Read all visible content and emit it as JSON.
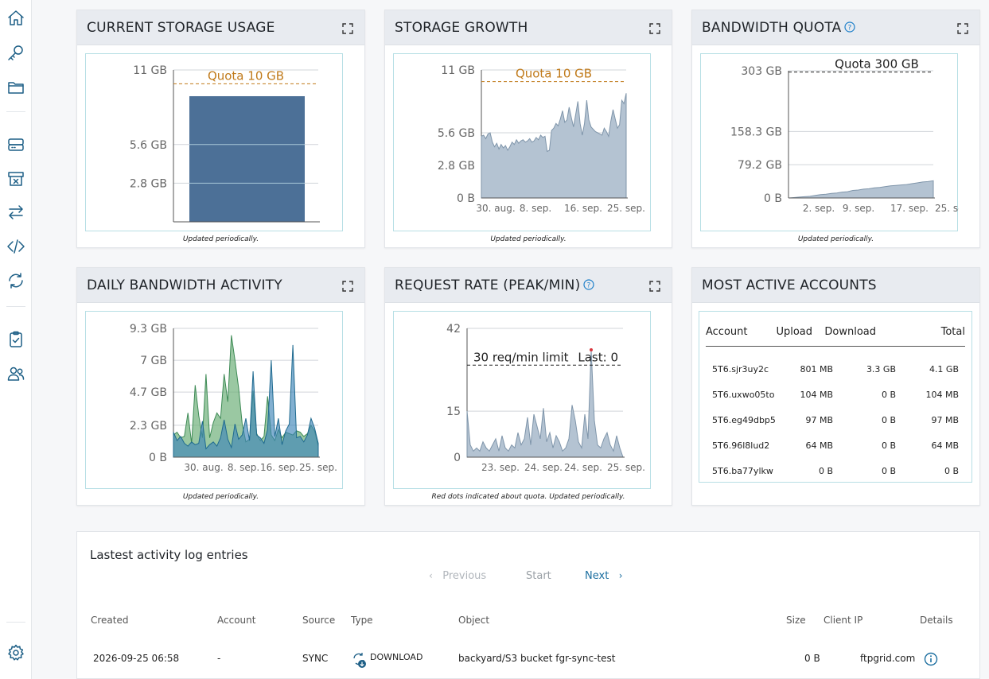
{
  "sidebar": {
    "icons": [
      "home-icon",
      "key-icon",
      "folder-icon",
      "server-icon",
      "archive-icon",
      "transfer-icon",
      "code-icon",
      "sync-icon",
      "clipboard-check-icon",
      "users-icon",
      "settings-icon"
    ]
  },
  "colors": {
    "accent": "#1d5f86",
    "quota_line": "#c07a1a",
    "area_fill": "#b4c3d2",
    "bar_fill": "#4c7097",
    "green": "#6fb07a",
    "blue": "#3f86b8",
    "red_dot": "#d9363e"
  },
  "cards": {
    "storage_usage": {
      "title": "CURRENT STORAGE USAGE",
      "note": "Updated periodically."
    },
    "storage_growth": {
      "title": "STORAGE GROWTH",
      "note": "Updated periodically."
    },
    "bandwidth_quota": {
      "title": "BANDWIDTH QUOTA",
      "note": "Updated periodically."
    },
    "daily_bandwidth": {
      "title": "DAILY BANDWIDTH ACTIVITY",
      "note": "Updated periodically."
    },
    "request_rate": {
      "title": "REQUEST RATE (PEAK/MIN)",
      "note": "Red dots indicated about quota. Updated periodically."
    },
    "active_accounts": {
      "title": "MOST ACTIVE ACCOUNTS",
      "columns": [
        "Account",
        "Upload",
        "Download",
        "Total"
      ],
      "rows": [
        [
          "5T6.sjr3uy2c",
          "801 MB",
          "3.3 GB",
          "4.1 GB"
        ],
        [
          "5T6.uxwo05to",
          "104 MB",
          "0 B",
          "104 MB"
        ],
        [
          "5T6.eg49dbp5",
          "97 MB",
          "0 B",
          "97 MB"
        ],
        [
          "5T6.96l8lud2",
          "64 MB",
          "0 B",
          "64 MB"
        ],
        [
          "5T6.ba77ylkw",
          "0 B",
          "0 B",
          "0 B"
        ]
      ]
    }
  },
  "chart_data": [
    {
      "id": "storage_usage",
      "type": "bar",
      "ytick_labels": [
        "2.8 GB",
        "5.6 GB",
        "11 GB"
      ],
      "yticks": [
        2.8,
        5.6,
        11
      ],
      "ylim": [
        0,
        11
      ],
      "values": [
        9.1
      ],
      "annotations": [
        {
          "text": "Quota 10 GB",
          "y": 10
        }
      ]
    },
    {
      "id": "storage_growth",
      "type": "area",
      "ytick_labels": [
        "0 B",
        "2.8 GB",
        "5.6 GB",
        "11 GB"
      ],
      "yticks": [
        0,
        2.8,
        5.6,
        11
      ],
      "ylim": [
        0,
        11
      ],
      "xtick_labels": [
        "30. aug.",
        "8. sep.",
        "16. sep.",
        "25. sep."
      ],
      "annotations": [
        {
          "text": "Quota 10 GB",
          "y": 10
        }
      ],
      "values": [
        5.3,
        5.4,
        5.1,
        5.5,
        5.6,
        4.8,
        4.4,
        4.7,
        4.2,
        4.6,
        4.3,
        4.5,
        4.1,
        4.4,
        4.8,
        4.6,
        5.0,
        4.7,
        4.9,
        5.0,
        4.8,
        4.9,
        5.1,
        4.8,
        4.9,
        5.2,
        5.0,
        5.4,
        5.2,
        5.3,
        4.0,
        4.1,
        5.8,
        6.0,
        6.4,
        6.2,
        6.8,
        7.5,
        6.5,
        6.7,
        7.8,
        6.9,
        6.1,
        7.2,
        8.3,
        6.4,
        5.4,
        6.4,
        8.4,
        6.7,
        6.1,
        5.9,
        5.7,
        5.6,
        5.5,
        5.4,
        6.0,
        5.7,
        5.3,
        6.6,
        7.6,
        6.8,
        6.0,
        6.3,
        8.4,
        8.1,
        9.0
      ]
    },
    {
      "id": "bandwidth_quota",
      "type": "area",
      "ytick_labels": [
        "0 B",
        "79.2 GB",
        "158.3 GB",
        "303 GB"
      ],
      "yticks": [
        0,
        79.2,
        158.3,
        303
      ],
      "ylim": [
        0,
        303
      ],
      "xtick_labels": [
        "2. sep.",
        "9. sep.",
        "17. sep.",
        "25. sep."
      ],
      "annotations": [
        {
          "text": "Quota 300 GB",
          "y": 300
        }
      ],
      "values": [
        0,
        1,
        2,
        3,
        4,
        6,
        8,
        9,
        11,
        12,
        14,
        15,
        18,
        19,
        21,
        22,
        24,
        25,
        27,
        29,
        30,
        31,
        32,
        34,
        36,
        38,
        39,
        41
      ]
    },
    {
      "id": "daily_bandwidth",
      "type": "area",
      "ytick_labels": [
        "0 B",
        "2.3 GB",
        "4.7 GB",
        "7 GB",
        "9.3 GB"
      ],
      "yticks": [
        0,
        2.3,
        4.7,
        7,
        9.3
      ],
      "ylim": [
        0,
        9.3
      ],
      "xtick_labels": [
        "30. aug.",
        "8. sep.",
        "16. sep.",
        "25. sep."
      ],
      "series": [
        {
          "values": [
            1.6,
            1.8,
            1.4,
            1.5,
            3.2,
            1.0,
            5.2,
            3.0,
            1.4,
            6.0,
            1.4,
            2.5,
            3.2,
            2.8,
            6.0,
            4.0,
            8.8,
            7.0,
            5.0,
            2.4,
            1.1,
            1.3,
            4.8,
            1.7,
            1.2,
            1.5,
            4.4,
            1.6,
            1.2,
            2.0,
            1.4,
            1.8,
            1.7,
            1.6,
            1.9,
            1.8,
            1.5,
            1.7,
            2.3,
            1.9,
            0.8
          ]
        },
        {
          "values": [
            1.8,
            1.2,
            1.5,
            1.0,
            0.8,
            1.1,
            0.9,
            1.0,
            2.6,
            0.6,
            0.9,
            1.1,
            0.8,
            1.4,
            2.7,
            1.3,
            0.7,
            2.4,
            1.3,
            1.6,
            2.8,
            1.2,
            6.2,
            1.6,
            1.4,
            1.0,
            2.0,
            7.0,
            1.5,
            2.8,
            0.9,
            1.9,
            2.4,
            8.1,
            1.4,
            1.5,
            1.1,
            1.6,
            2.8,
            2.1,
            1.0
          ]
        }
      ]
    },
    {
      "id": "request_rate",
      "type": "area",
      "ytick_labels": [
        "0",
        "15",
        "42"
      ],
      "yticks": [
        0,
        15,
        42
      ],
      "ylim": [
        0,
        42
      ],
      "xtick_labels": [
        "23. sep.",
        "24. sep.",
        "24. sep.",
        "25. sep."
      ],
      "annotations": [
        {
          "text": "30 req/min limit",
          "y": 30
        },
        {
          "text": "Last: 0"
        }
      ],
      "values": [
        15,
        4,
        2,
        3,
        2,
        5,
        3,
        2,
        4,
        6,
        2,
        7,
        3,
        2,
        4,
        3,
        8,
        4,
        6,
        13,
        4,
        14,
        10,
        6,
        16,
        5,
        8,
        3,
        7,
        5,
        2,
        3,
        6,
        17,
        12,
        5,
        3,
        14,
        6,
        35,
        12,
        4,
        3,
        6,
        8,
        4,
        2,
        7,
        3,
        0
      ]
    }
  ],
  "log": {
    "title": "Lastest activity log entries",
    "pager": {
      "previous": "Previous",
      "start": "Start",
      "next": "Next"
    },
    "columns": [
      "Created",
      "Account",
      "Source",
      "Type",
      "Object",
      "Size",
      "Client IP",
      "Details"
    ],
    "rows": [
      {
        "created": "2026-09-25 06:58",
        "account": "-",
        "source": "SYNC",
        "type": "DOWNLOAD",
        "object": "backyard/S3 bucket fgr-sync-test",
        "size": "0 B",
        "client_ip": "ftpgrid.com"
      }
    ]
  }
}
